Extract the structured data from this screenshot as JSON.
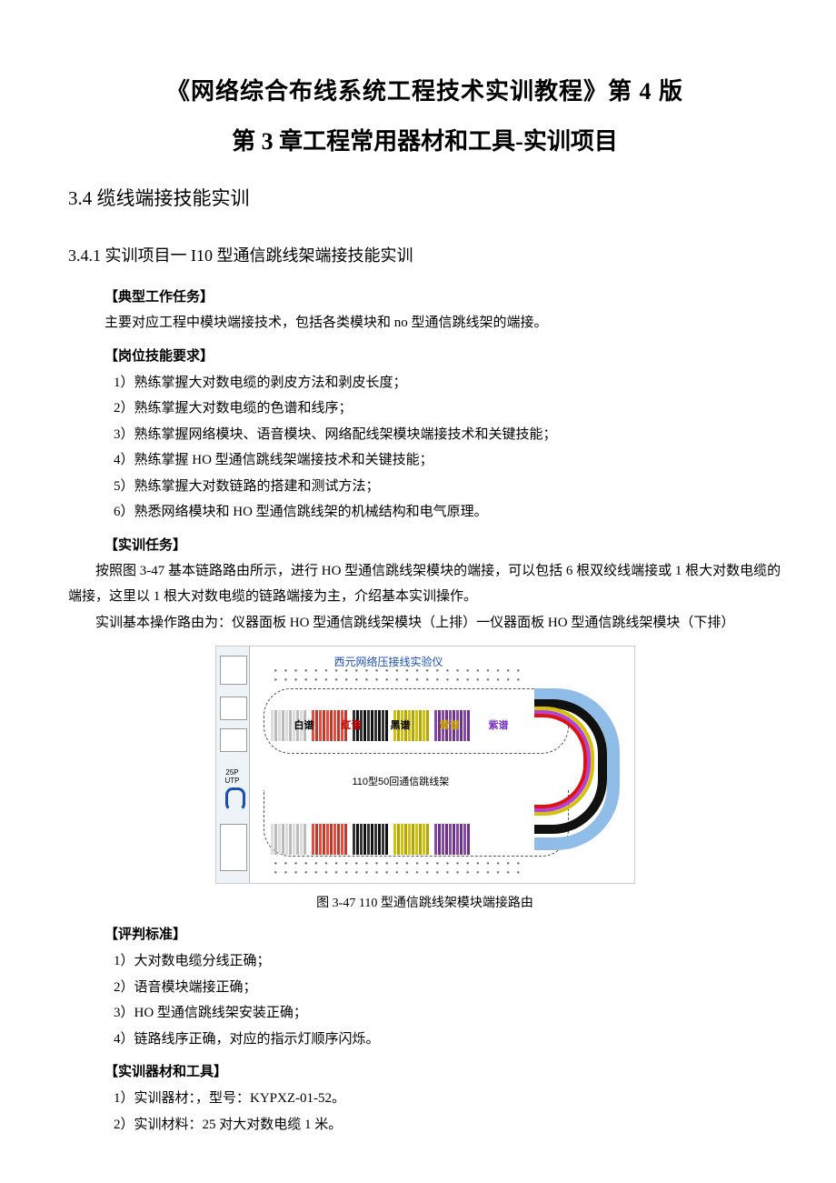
{
  "title_main": "《网络综合布线系统工程技术实训教程》第 4 版",
  "title_sub": "第 3 章工程常用器材和工具-实训项目",
  "section": "3.4 缆线端接技能实训",
  "subsection": "3.4.1 实训项目一 I10 型通信跳线架端接技能实训",
  "labels": {
    "task": "【典型工作任务】",
    "skill": "【岗位技能要求】",
    "training": "【实训任务】",
    "judge": "【评判标准】",
    "equip": "【实训器材和工具】"
  },
  "task_para": "主要对应工程中模块端接技术，包括各类模块和 no 型通信跳线架的端接。",
  "skills": [
    "1）熟练掌握大对数电缆的剥皮方法和剥皮长度；",
    "2）熟练掌握大对数电缆的色谱和线序；",
    "3）熟练掌握网络模块、语音模块、网络配线架模块端接技术和关键技能；",
    "4）熟练掌握 HO 型通信跳线架端接技术和关键技能；",
    "5）熟练掌握大对数链路的搭建和测试方法；",
    "6）熟悉网络模块和 HO 型通信跳线架的机械结构和电气原理。"
  ],
  "training_paras": [
    "按照图 3-47 基本链路路由所示，进行 HO 型通信跳线架模块的端接，可以包括 6 根双绞线端接或 1 根大对数电缆的端接，这里以 1 根大对数电缆的链路端接为主，介绍基本实训操作。",
    "实训基本操作路由为：仪器面板 HO 型通信跳线架模块（上排）一仪器面板 HO 型通信跳线架模块（下排）"
  ],
  "figure": {
    "caption": "图 3-47 110 型通信跳线架模块端接路由",
    "inner_title": "西元网络压接线实验仪",
    "rack_label": "110型50回通信跳线架",
    "bands": [
      "白谱",
      "红谱",
      "黑谱",
      "黄谱",
      "紫谱"
    ],
    "side_label_top": "25P",
    "side_label_bot": "UTP"
  },
  "judge": [
    "1）大对数电缆分线正确；",
    "2）语音模块端接正确；",
    "3）HO 型通信跳线架安装正确；",
    "4）链路线序正确，对应的指示灯顺序闪烁。"
  ],
  "equip": [
    "1）实训器材：，型号：KYPXZ-01-52。",
    "2）实训材料：25 对大对数电缆 1 米。"
  ]
}
